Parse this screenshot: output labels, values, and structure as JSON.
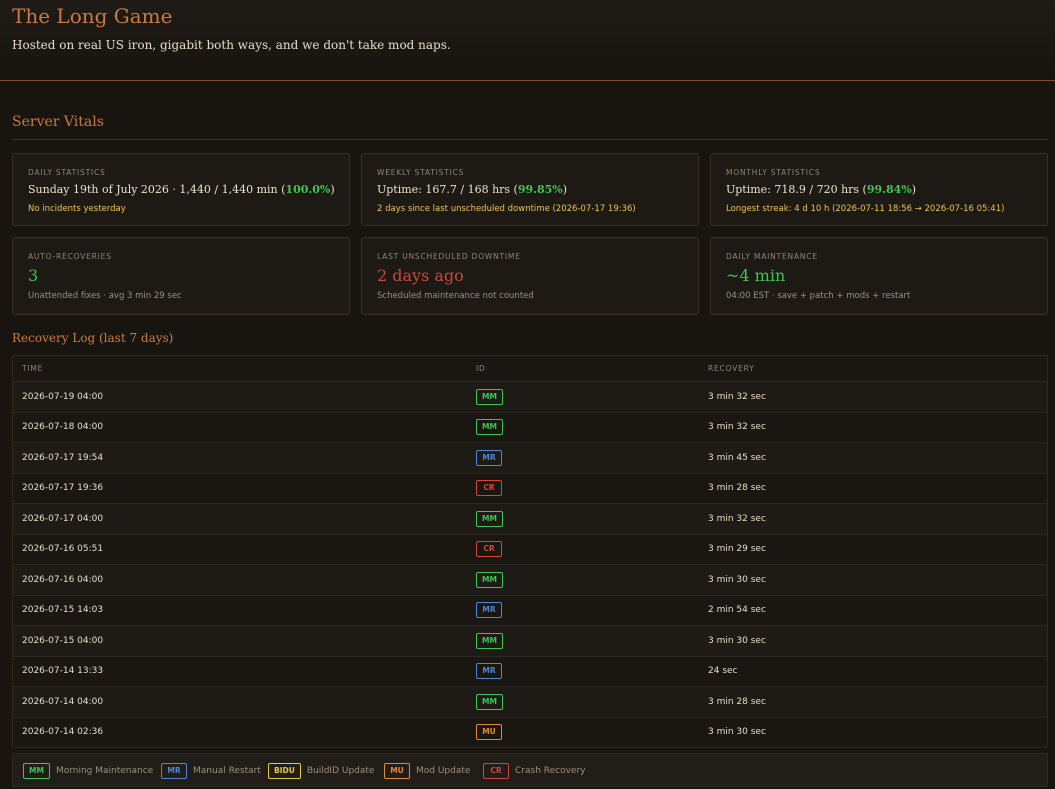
{
  "header": {
    "title": "The Long Game",
    "tagline": "Hosted on real US iron, gigabit both ways, and we don't take mod naps."
  },
  "vitals": {
    "section_title": "Server Vitals",
    "daily": {
      "label": "Daily Statistics",
      "main_prefix": "Sunday 19th of July 2026 · 1,440 / 1,440 min (",
      "main_pct": "100.0%",
      "main_suffix": ")",
      "sub": "No incidents yesterday"
    },
    "weekly": {
      "label": "Weekly Statistics",
      "main_prefix": "Uptime: 167.7 / 168 hrs (",
      "main_pct": "99.85%",
      "main_suffix": ")",
      "sub": "2 days since last unscheduled downtime (2026-07-17 19:36)"
    },
    "monthly": {
      "label": "Monthly Statistics",
      "main_prefix": "Uptime: 718.9 / 720 hrs (",
      "main_pct": "99.84%",
      "main_suffix": ")",
      "sub": "Longest streak: 4 d 10 h (2026-07-11 18:56 → 2026-07-16 05:41)"
    },
    "auto_recoveries": {
      "label": "Auto-Recoveries",
      "value": "3",
      "sub": "Unattended fixes · avg 3 min 29 sec"
    },
    "last_downtime": {
      "label": "Last Unscheduled Downtime",
      "value": "2 days ago",
      "sub": "Scheduled maintenance not counted"
    },
    "maintenance": {
      "label": "Daily Maintenance",
      "value": "~4 min",
      "sub": "04:00 EST · save + patch + mods + restart"
    }
  },
  "log": {
    "title": "Recovery Log (last 7 days)",
    "columns": [
      "TIME",
      "ID",
      "RECOVERY"
    ],
    "rows": [
      {
        "time": "2026-07-19 04:00",
        "id": "MM",
        "recovery": "3 min 32 sec"
      },
      {
        "time": "2026-07-18 04:00",
        "id": "MM",
        "recovery": "3 min 32 sec"
      },
      {
        "time": "2026-07-17 19:54",
        "id": "MR",
        "recovery": "3 min 45 sec"
      },
      {
        "time": "2026-07-17 19:36",
        "id": "CR",
        "recovery": "3 min 28 sec"
      },
      {
        "time": "2026-07-17 04:00",
        "id": "MM",
        "recovery": "3 min 32 sec"
      },
      {
        "time": "2026-07-16 05:51",
        "id": "CR",
        "recovery": "3 min 29 sec"
      },
      {
        "time": "2026-07-16 04:00",
        "id": "MM",
        "recovery": "3 min 30 sec"
      },
      {
        "time": "2026-07-15 14:03",
        "id": "MR",
        "recovery": "2 min 54 sec"
      },
      {
        "time": "2026-07-15 04:00",
        "id": "MM",
        "recovery": "3 min 30 sec"
      },
      {
        "time": "2026-07-14 13:33",
        "id": "MR",
        "recovery": "24 sec"
      },
      {
        "time": "2026-07-14 04:00",
        "id": "MM",
        "recovery": "3 min 28 sec"
      },
      {
        "time": "2026-07-14 02:36",
        "id": "MU",
        "recovery": "3 min 30 sec"
      }
    ]
  },
  "legend": [
    {
      "code": "MM",
      "label": "Morning Maintenance"
    },
    {
      "code": "MR",
      "label": "Manual Restart"
    },
    {
      "code": "BIDU",
      "label": "BuildID Update"
    },
    {
      "code": "MU",
      "label": "Mod Update"
    },
    {
      "code": "CR",
      "label": "Crash Recovery"
    }
  ],
  "colors": {
    "accent": "#cc7a3d",
    "good": "#3fc552",
    "bad": "#c64a3e",
    "warn": "#e8c64a",
    "mm": "#3fc552",
    "mr": "#4d86d6",
    "cr": "#d2453b",
    "mu": "#e0873a",
    "bidu": "#e8c64a"
  }
}
